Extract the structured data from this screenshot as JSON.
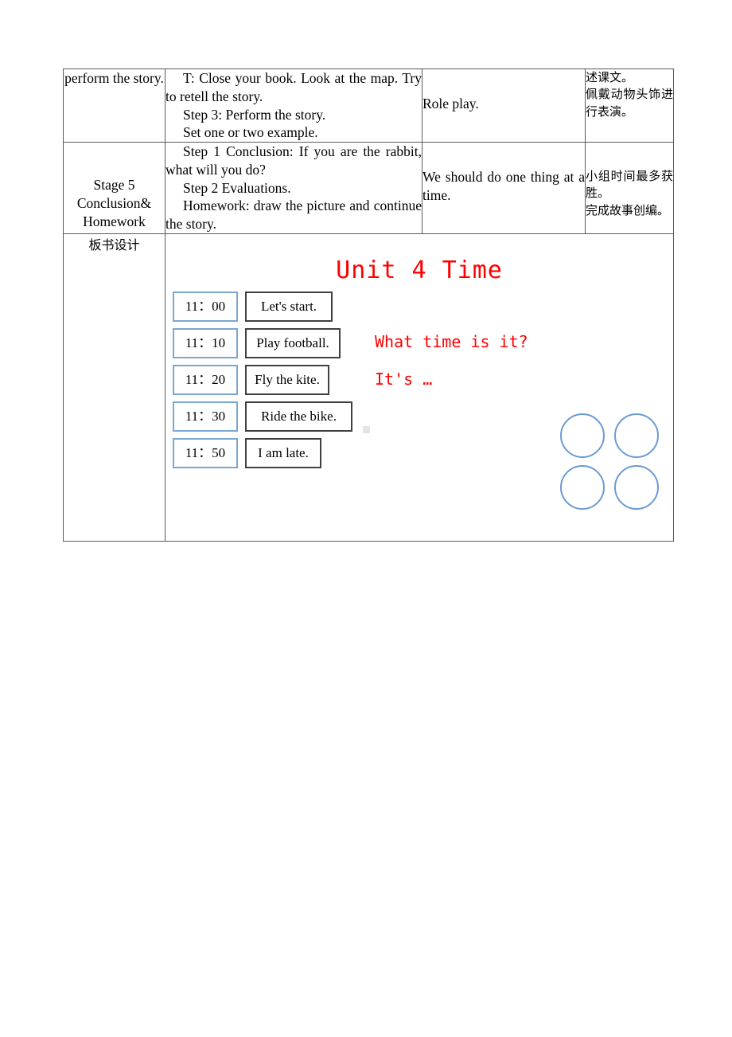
{
  "table": {
    "rows": [
      {
        "stage": "perform the story.",
        "procedure": [
          "T: Close your book. Look at the map. Try to retell the story.",
          "Step 3: Perform the story.",
          "Set one or two example."
        ],
        "language": "Role play.",
        "notes": [
          "述课文。",
          "佩戴动物头饰进行表演。"
        ]
      },
      {
        "stage": "Stage 5 Conclusion& Homework",
        "stage_lines": [
          "Stage 5",
          "Conclusion&",
          "Homework"
        ],
        "procedure": [
          "Step 1 Conclusion: If you are the rabbit, what will you do?",
          "Step 2 Evaluations.",
          "Homework: draw the picture and continue the story."
        ],
        "language": "We should do one thing at a time.",
        "notes": [
          "小组时间最多获胜。",
          "完成故事创编。"
        ]
      }
    ],
    "board_row_label": "板书设计"
  },
  "board": {
    "title": "Unit 4 Time",
    "schedule": [
      {
        "time": "11：00",
        "activity": "Let's start.",
        "width": 108
      },
      {
        "time": "11：10",
        "activity": "Play football.",
        "width": 118
      },
      {
        "time": "11：20",
        "activity": "Fly the kite.",
        "width": 104
      },
      {
        "time": "11：30",
        "activity": "Ride the bike.",
        "width": 133
      },
      {
        "time": "11：50",
        "activity": "I am late.",
        "width": 94
      }
    ],
    "question": "What time is it?",
    "answer": "It's …",
    "circle_count": 4,
    "colors": {
      "title_red": "#ff0000",
      "time_box_border": "#7ba7d0",
      "activity_box_border": "#404040",
      "circle_border": "#6b9bd2"
    }
  }
}
